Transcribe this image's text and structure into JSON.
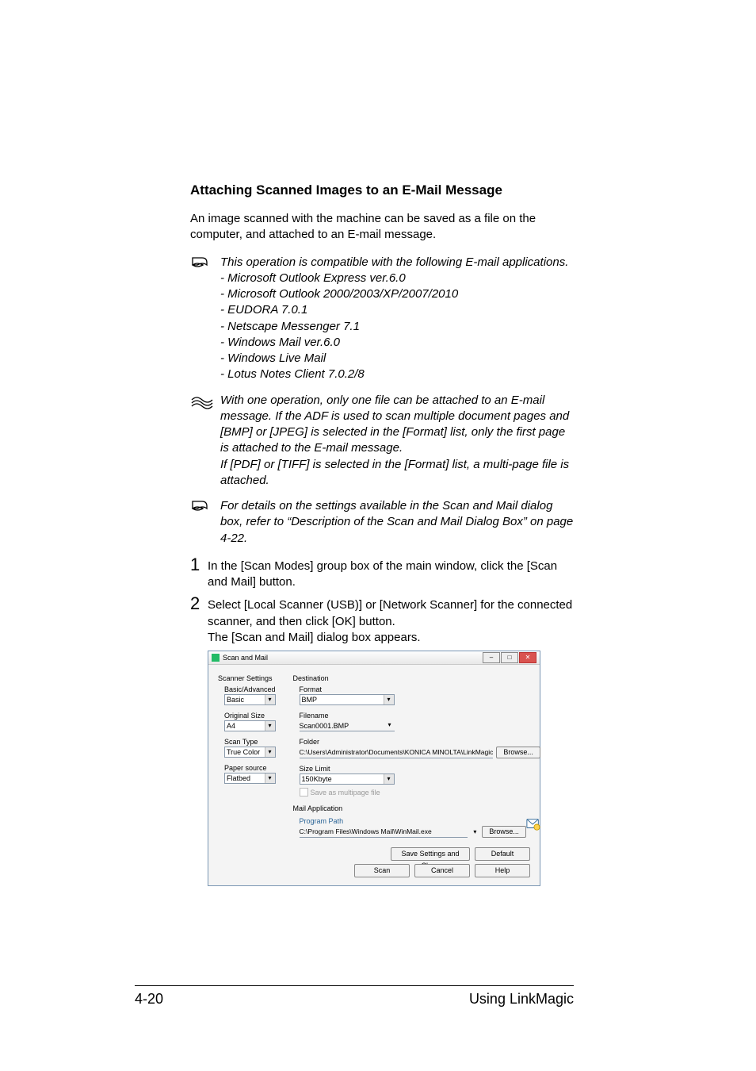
{
  "heading": "Attaching Scanned Images to an E-Mail Message",
  "intro": "An image scanned with the machine can be saved as a file on the computer, and attached to an E-mail message.",
  "notes": {
    "compat_intro": "This operation is compatible with the following E-mail applications.",
    "compat_list": [
      "- Microsoft Outlook Express ver.6.0",
      "- Microsoft Outlook 2000/2003/XP/2007/2010",
      "- EUDORA 7.0.1",
      "- Netscape Messenger 7.1",
      "- Windows Mail ver.6.0",
      "- Windows Live Mail",
      "- Lotus Notes Client 7.0.2/8"
    ],
    "one_file_a": "With one operation, only one file can be attached to an E-mail message. If the ADF is used to scan multiple document pages and [BMP] or [JPEG] is selected in the [Format] list, only the first page is attached to the E-mail message.",
    "one_file_b": "If [PDF] or [TIFF] is selected in the [Format] list, a multi-page file is attached.",
    "details": "For details on the settings available in the Scan and Mail dialog box, refer to “Description of the Scan and Mail Dialog Box” on page 4-22."
  },
  "steps": {
    "s1": "In the [Scan Modes] group box of the main window, click the [Scan and Mail] button.",
    "s1n": "1",
    "s2a": "Select [Local Scanner (USB)] or [Network Scanner] for the connected scanner, and then click [OK] button.",
    "s2b": "The [Scan and Mail] dialog box appears.",
    "s2n": "2"
  },
  "dialog": {
    "title": "Scan and Mail",
    "scanner_settings": "Scanner Settings",
    "basic_advanced_lbl": "Basic/Advanced",
    "basic_advanced_val": "Basic",
    "original_size_lbl": "Original Size",
    "original_size_val": "A4",
    "scan_type_lbl": "Scan Type",
    "scan_type_val": "True Color",
    "paper_source_lbl": "Paper source",
    "paper_source_val": "Flatbed",
    "destination": "Destination",
    "format_lbl": "Format",
    "format_val": "BMP",
    "filename_lbl": "Filename",
    "filename_val": "Scan0001.BMP",
    "folder_lbl": "Folder",
    "folder_val": "C:\\Users\\Administrator\\Documents\\KONICA MINOLTA\\LinkMagic",
    "browse": "Browse...",
    "size_limit_lbl": "Size Limit",
    "size_limit_val": "150Kbyte",
    "save_multipage": "Save as multipage file",
    "mail_app": "Mail Application",
    "program_path_lbl": "Program Path",
    "program_path_val": "C:\\Program Files\\Windows Mail\\WinMail.exe",
    "save_close": "Save Settings and Close",
    "default": "Default",
    "scan": "Scan",
    "cancel": "Cancel",
    "help": "Help"
  },
  "footer": {
    "page": "4-20",
    "section": "Using LinkMagic"
  }
}
